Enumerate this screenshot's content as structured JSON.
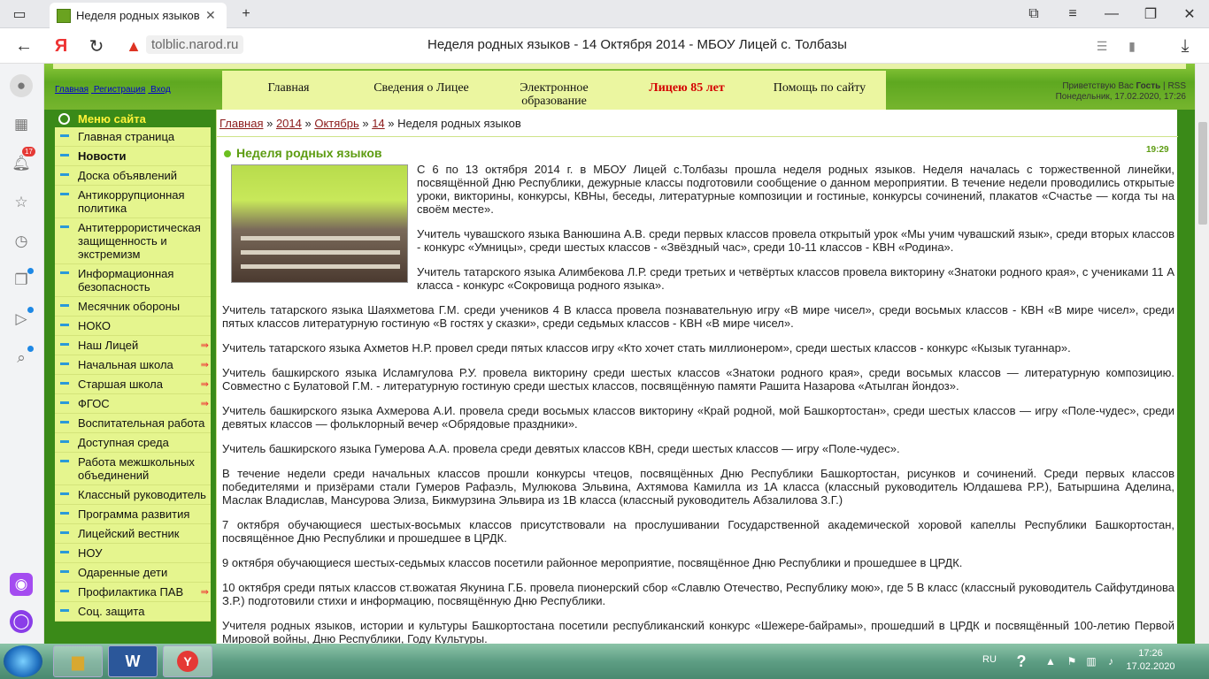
{
  "browser": {
    "tab_title": "Неделя родных языков",
    "domain": "tolblic.narod.ru",
    "page_title": "Неделя родных языков - 14 Октября 2014 - МБОУ Лицей с. Толбазы",
    "yandex_logo": "Я",
    "notification_count": "17"
  },
  "header": {
    "links": [
      "Главная",
      "Регистрация",
      "Вход"
    ],
    "menu": [
      "Главная",
      "Сведения о Лицее",
      "Электронное образование",
      "Лицею 85 лет",
      "Помощь по сайту"
    ],
    "greeting_prefix": "Приветствую Вас",
    "greeting_user": "Гость",
    "rss": "RSS",
    "date_line": "Понедельник, 17.02.2020, 17:26"
  },
  "sidebar": {
    "title": "Меню сайта",
    "items": [
      {
        "label": "Главная страница"
      },
      {
        "label": "Новости"
      },
      {
        "label": "Доска объявлений"
      },
      {
        "label": "Антикоррупционная политика"
      },
      {
        "label": "Антитеррористическая защищенность и экстремизм"
      },
      {
        "label": "Информационная безопасность"
      },
      {
        "label": "Месячник обороны"
      },
      {
        "label": "НОКО"
      },
      {
        "label": "Наш Лицей"
      },
      {
        "label": "Начальная школа"
      },
      {
        "label": "Старшая школа"
      },
      {
        "label": "ФГОС"
      },
      {
        "label": "Воспитательная работа"
      },
      {
        "label": "Доступная среда"
      },
      {
        "label": "Работа межшкольных объединений"
      },
      {
        "label": "Классный руководитель"
      },
      {
        "label": "Программа развития"
      },
      {
        "label": "Лицейский вестник"
      },
      {
        "label": "НОУ"
      },
      {
        "label": "Одаренные дети"
      },
      {
        "label": "Профилактика ПАВ"
      },
      {
        "label": "Соц. защита"
      }
    ]
  },
  "breadcrumb": [
    "Главная",
    "2014",
    "Октябрь",
    "14",
    "Неделя родных языков"
  ],
  "article": {
    "title": "Неделя родных языков",
    "time": "19:29",
    "paragraphs": [
      "С 6 по 13 октября 2014 г. в МБОУ Лицей с.Толбазы прошла неделя родных языков. Неделя началась с торжественной линейки, посвящённой Дню Республики, дежурные классы подготовили сообщение о данном мероприятии. В течение недели проводились открытые уроки, викторины, конкурсы, КВНы, беседы, литературные композиции и гостиные, конкурсы сочинений, плакатов «Счастье — когда ты на своём месте».",
      "Учитель чувашского языка Ванюшина А.В. среди первых классов провела открытый урок «Мы учим чувашский язык», среди вторых классов - конкурс «Умницы», среди шестых классов - «Звёздный час», среди 10-11 классов - КВН «Родина».",
      "Учитель татарского языка Алимбекова Л.Р. среди третьих и четвёртых классов провела викторину «Знатоки родного края», с учениками 11 А класса - конкурс «Сокровища родного языка».",
      "Учитель татарского языка Шаяхметова Г.М. среди учеников 4 В класса провела познавательную игру «В мире чисел», среди восьмых классов - КВН «В мире чисел», среди пятых классов литературную гостиную «В гостях у сказки», среди седьмых классов - КВН «В мире чисел».",
      "Учитель татарского языка Ахметов Н.Р. провел среди пятых классов игру «Кто хочет стать миллионером», среди шестых классов - конкурс «Кызык туганнар».",
      "Учитель башкирского языка Исламгулова Р.У. провела викторину среди шестых классов «Знатоки родного края», среди восьмых классов — литературную композицию. Совместно с Булатовой Г.М. - литературную гостиную среди шестых классов, посвящённую памяти Рашита Назарова «Атылган йондоз».",
      "Учитель башкирского языка Ахмерова А.И. провела среди восьмых классов викторину «Край родной, мой Башкортостан», среди шестых классов — игру «Поле-чудес», среди девятых классов — фольклорный вечер «Обрядовые праздники».",
      "Учитель башкирского языка Гумерова А.А. провела среди девятых классов КВН, среди шестых классов — игру «Поле-чудес».",
      "В течение недели среди начальных классов прошли конкурсы чтецов, посвящённых Дню Республики Башкортостан, рисунков и сочинений. Среди первых классов победителями и призёрами стали Гумеров Рафаэль, Мулюкова Эльвина, Ахтямова Камилла из 1А класса (классный руководитель Юлдашева Р.Р.), Батыршина Аделина, Маслак Владислав, Мансурова Элиза, Бикмурзина Эльвира из 1В класса (классный руководитель Абзалилова З.Г.)",
      "7 октября обучающиеся шестых-восьмых классов присутствовали на прослушивании Государственной академической хоровой капеллы Республики Башкортостан, посвящённое Дню Республики и прошедшее в ЦРДК.",
      "9 октября обучающиеся шестых-седьмых классов посетили районное мероприятие, посвящённое Дню Республики и прошедшее в ЦРДК.",
      "10 октября среди пятых классов ст.вожатая Якунина Г.Б. провела пионерский сбор «Славлю Отечество, Республику мою», где 5 В класс (классный руководитель Сайфутдинова З.Р.) подготовили стихи и информацию, посвящённую Дню Республики.",
      "Учителя родных языков, истории и культуры Башкортостана посетили республиканский конкурс «Шежере-байрамы», прошедший в ЦРДК и посвящённый 100-летию Первой Мировой войны, Дню Республики, Году Культуры."
    ]
  },
  "taskbar": {
    "lang": "RU",
    "time": "17:26",
    "date": "17.02.2020"
  }
}
